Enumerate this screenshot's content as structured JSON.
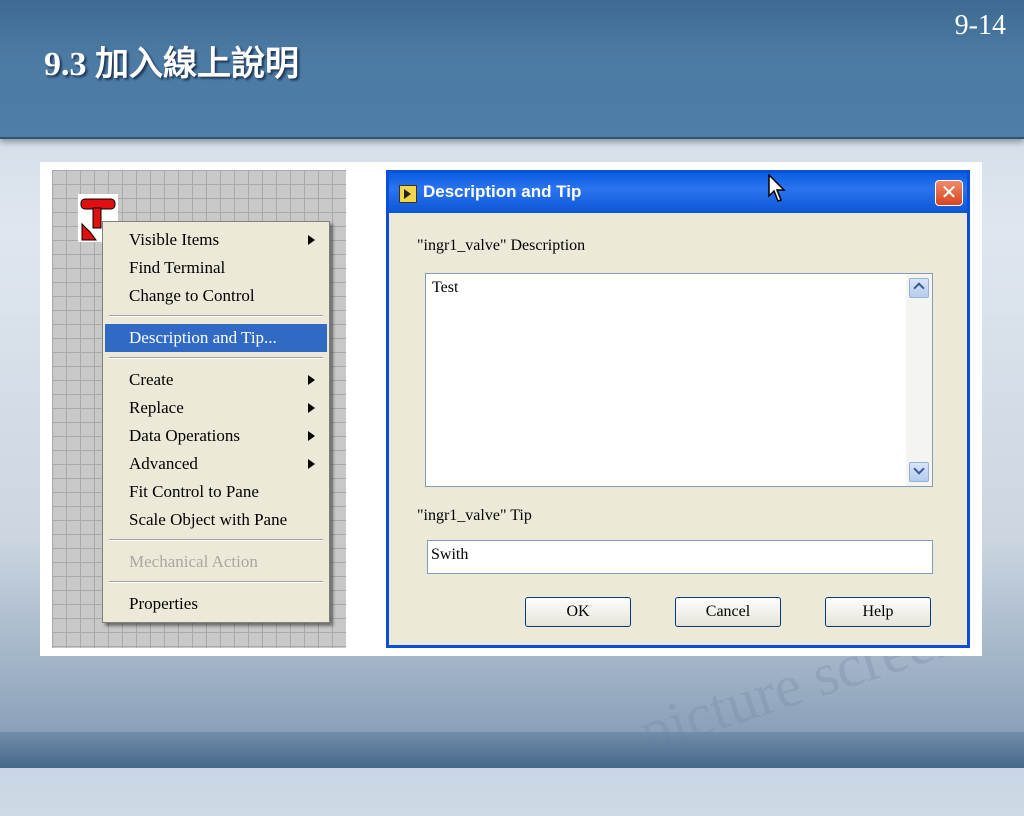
{
  "slide": {
    "page_number": "9-14",
    "title": "9.3 加入線上說明",
    "watermark": "picture screen"
  },
  "context_menu": {
    "items": [
      {
        "label": "Visible Items",
        "submenu": true
      },
      {
        "label": "Find Terminal",
        "submenu": false
      },
      {
        "label": "Change to Control",
        "submenu": false
      },
      {
        "label": "Description and Tip...",
        "submenu": false,
        "selected": true
      },
      {
        "label": "Create",
        "submenu": true
      },
      {
        "label": "Replace",
        "submenu": true
      },
      {
        "label": "Data Operations",
        "submenu": true
      },
      {
        "label": "Advanced",
        "submenu": true
      },
      {
        "label": "Fit Control to Pane",
        "submenu": false
      },
      {
        "label": "Scale Object with Pane",
        "submenu": false
      },
      {
        "label": "Mechanical Action",
        "submenu": false,
        "disabled": true
      },
      {
        "label": "Properties",
        "submenu": false
      }
    ]
  },
  "dialog": {
    "title": "Description and Tip",
    "close_symbol": "✕",
    "description_label": "\"ingr1_valve\" Description",
    "description_value": "Test",
    "tip_label": "\"ingr1_valve\" Tip",
    "tip_value": "Swith",
    "ok_label": "OK",
    "cancel_label": "Cancel",
    "help_label": "Help"
  },
  "colors": {
    "header": "#4b7aa3",
    "menu_highlight": "#316ac5",
    "titlebar": "#0a5ee0",
    "dialog_bg": "#ece9d8"
  }
}
